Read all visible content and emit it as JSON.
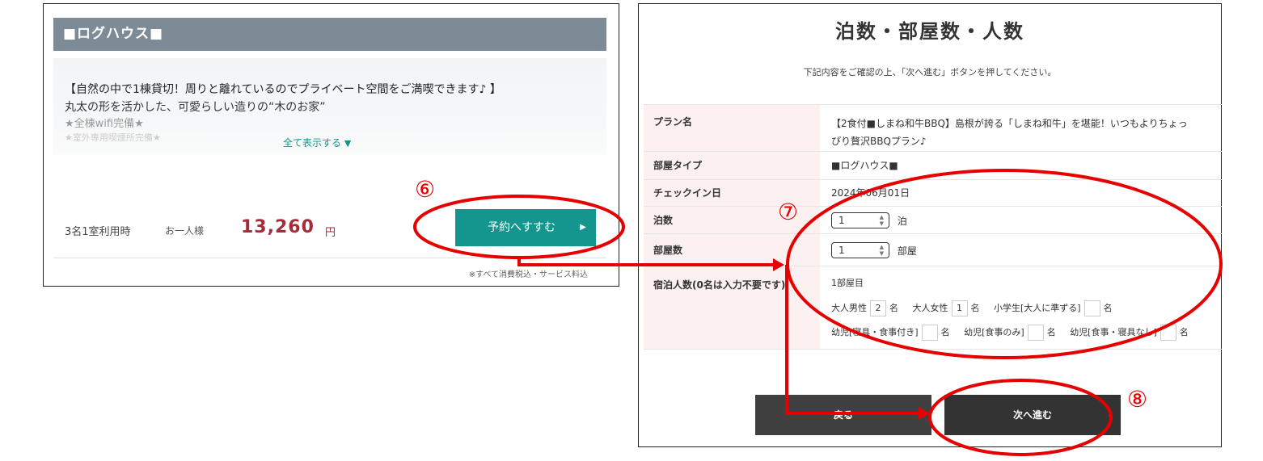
{
  "left": {
    "room_title": "■ログハウス■",
    "desc_lines": [
      "【自然の中で1棟貸切！周りと離れているのでプライベート空間をご満喫できます♪ 】",
      "丸太の形を活かした、可愛らしい造りの“木のお家”",
      "★全棟wifi完備★",
      "★室外専用喫煙所完備★"
    ],
    "show_all": "全て表示する",
    "usage": "3名1室利用時",
    "per_person": "お一人様",
    "price": "13,260",
    "yen": "円",
    "reserve_button": "予約へすすむ",
    "tax_note": "※すべて消費税込・サービス料込"
  },
  "right": {
    "title": "泊数・部屋数・人数",
    "subtitle": "下記内容をご確認の上、「次へ進む」ボタンを押してください。",
    "rows": {
      "plan": {
        "label": "プラン名",
        "value_line1": "【2食付■しまね和牛BBQ】島根が誇る「しまね和牛」を堪能！いつもよりちょっ",
        "value_line2": "ぴり贅沢BBQプラン♪"
      },
      "room_type": {
        "label": "部屋タイプ",
        "value": "■ログハウス■"
      },
      "checkin": {
        "label": "チェックイン日",
        "value": "2024年06月01日"
      },
      "nights": {
        "label": "泊数",
        "value": "1",
        "unit": "泊"
      },
      "rooms": {
        "label": "部屋数",
        "value": "1",
        "unit": "部屋"
      },
      "guests": {
        "label": "宿泊人数(0名は入力不要です)",
        "floor": "1部屋目",
        "adult_male_label": "大人男性",
        "adult_male": "2",
        "adult_female_label": "大人女性",
        "adult_female": "1",
        "elementary_label": "小学生[大人に準ずる]",
        "elementary": "",
        "infant_full_label": "幼児[寝具・食事付き]",
        "infant_full": "",
        "infant_meal_label": "幼児[食事のみ]",
        "infant_meal": "",
        "infant_none_label": "幼児[食事・寝具なし]",
        "infant_none": "",
        "unit": "名"
      }
    },
    "back_button": "戻る",
    "next_button": "次へ進む"
  },
  "annotations": {
    "step6": "⑥",
    "step7": "⑦",
    "step8": "⑧",
    "color": "#e60000"
  }
}
